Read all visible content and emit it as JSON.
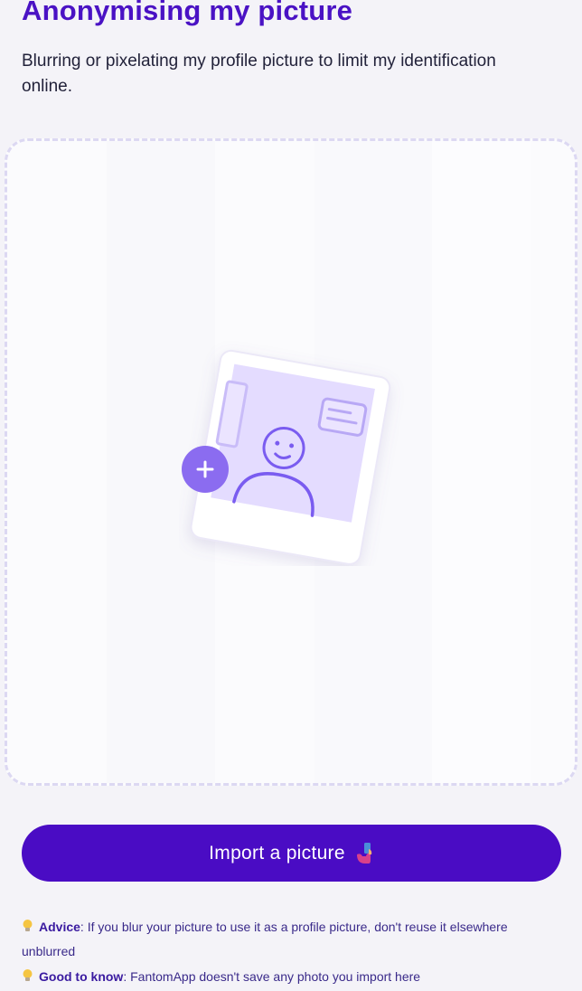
{
  "header": {
    "title": "Anonymising my picture",
    "subtitle": "Blurring or pixelating my profile picture to limit my identification online."
  },
  "dropzone": {
    "illustration_icon": "photo-portrait-icon",
    "add_icon": "plus-icon"
  },
  "import_button": {
    "label": "Import a picture",
    "emoji_icon": "selfie-emoji-icon"
  },
  "notes": [
    {
      "icon": "lightbulb-icon",
      "label": "Advice",
      "text": ": If you blur your picture to use it as a profile picture, don't reuse it elsewhere unblurred"
    },
    {
      "icon": "lightbulb-icon",
      "label": "Good to know",
      "text": ": FantomApp doesn't save any photo you import here"
    }
  ],
  "colors": {
    "accent": "#4a12c4",
    "button": "#4a0cc4",
    "plus_circle": "#8b6cf0",
    "illustration_fill": "#e4dcff",
    "illustration_stroke": "#7a5cf0"
  }
}
